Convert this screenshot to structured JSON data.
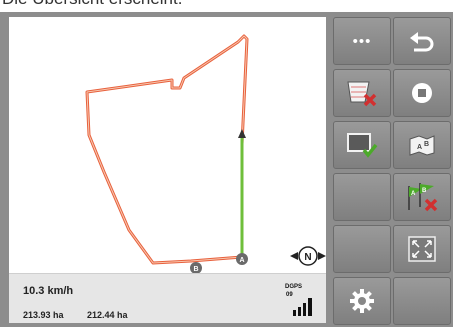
{
  "caption": "Die Übersicht erscheint.",
  "status": {
    "speed": "10.3 km/h",
    "area_total": "213.93 ha",
    "area_worked": "212.44 ha",
    "gps_mode": "DGPS",
    "gps_satellites": "09"
  },
  "markers": {
    "point_a": "A",
    "point_b": "B"
  },
  "compass_label": "N",
  "menu_button_label": "•••",
  "icons": {
    "menu": "more-dots-icon",
    "back": "return-arrow-icon",
    "delete_field": "delete-field-icon",
    "stop_record": "stop-record-icon",
    "confirm_field": "confirm-field-icon",
    "field_ab": "field-ab-icon",
    "delete_ab": "delete-ab-flags-icon",
    "fullscreen": "fullscreen-icon",
    "settings": "gear-icon",
    "compass": "compass-north-icon",
    "gps_signal": "gps-signal-icon"
  },
  "colors": {
    "boundary": "#e8603c",
    "ab_line": "#6fbf3b",
    "panel": "#8d8d8d",
    "button": "#8a8a8a",
    "delete_red": "#d23030",
    "confirm_green": "#4caa2a"
  }
}
